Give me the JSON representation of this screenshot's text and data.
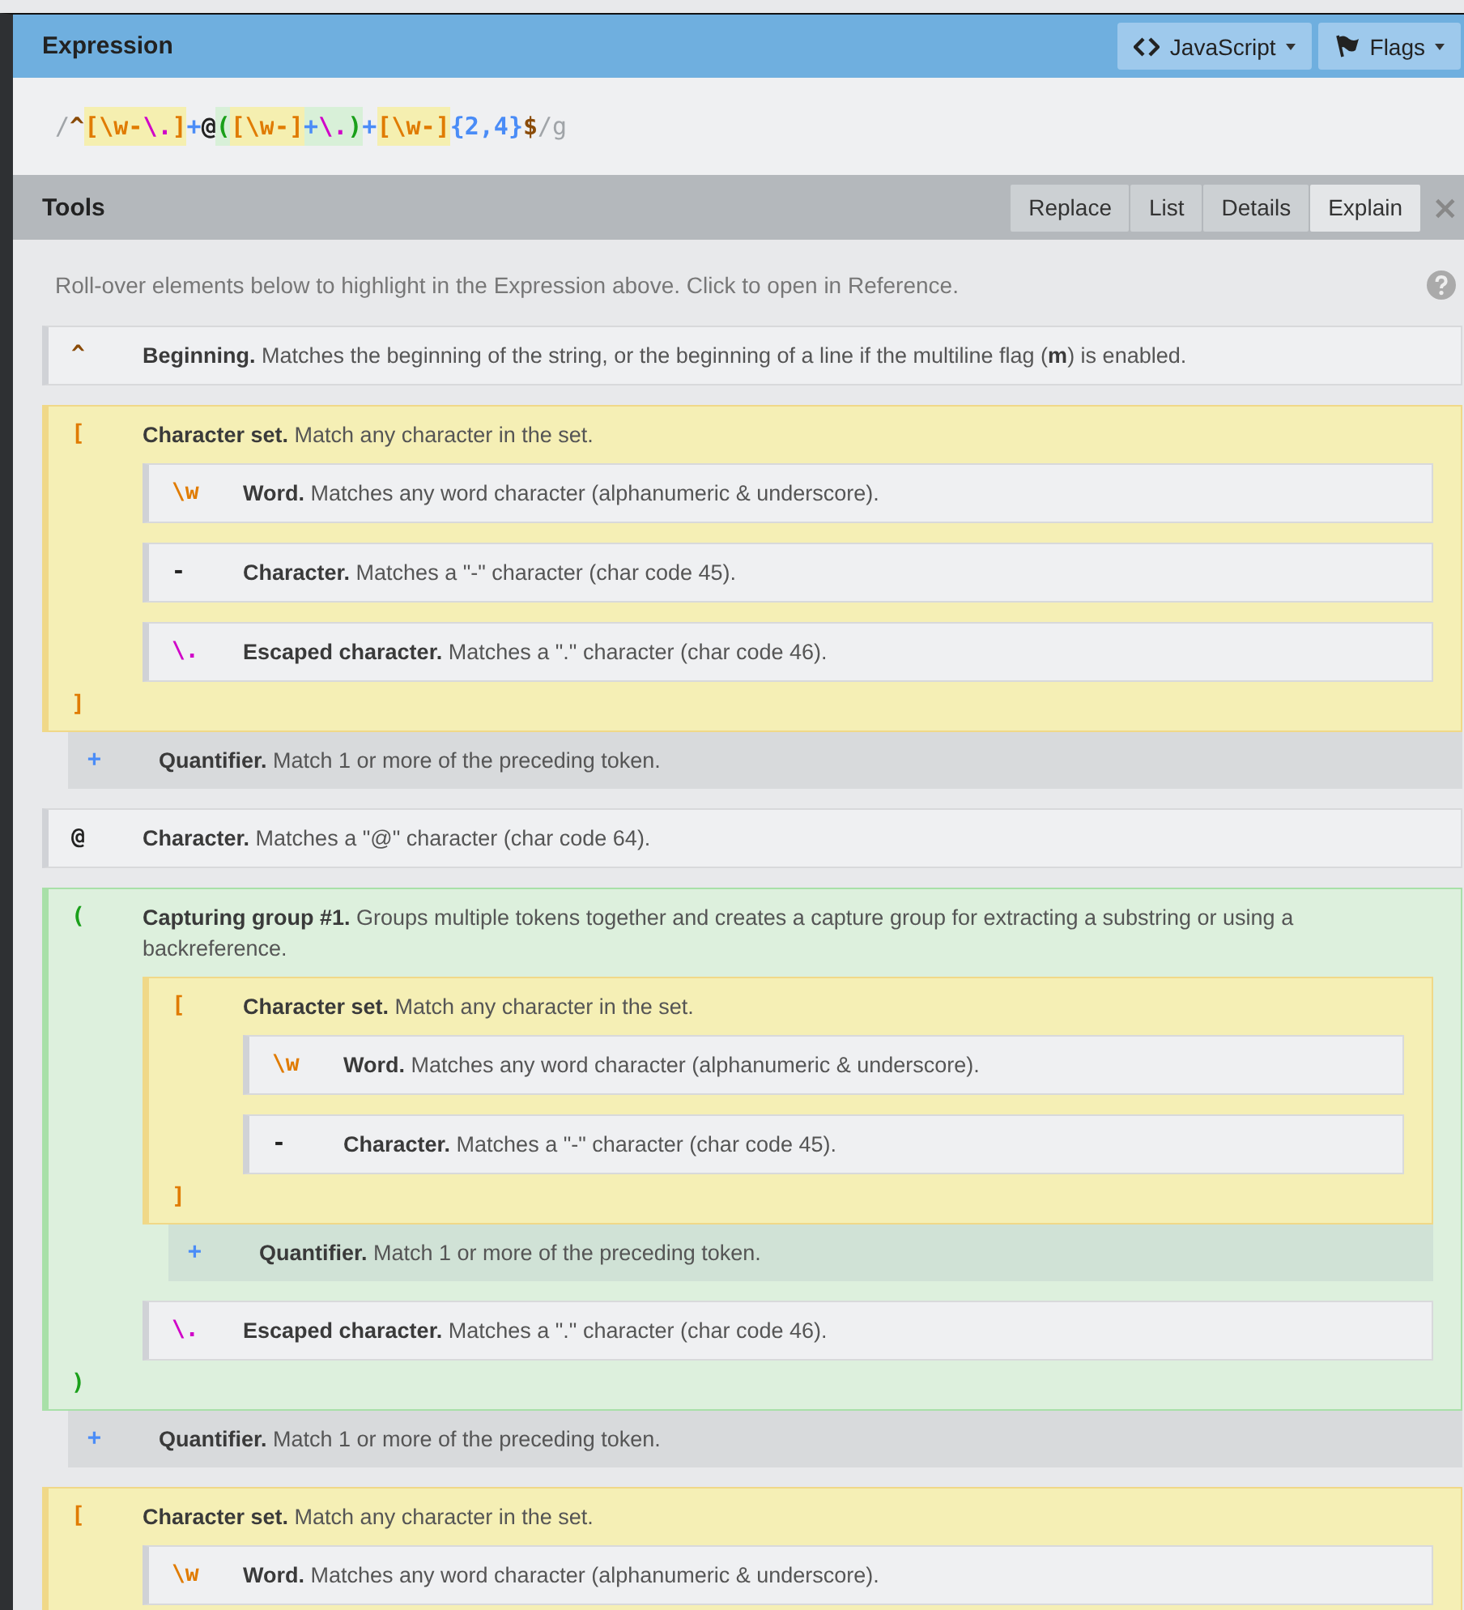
{
  "header": {
    "title": "Expression",
    "buttons": [
      {
        "kind": "code",
        "label": "JavaScript"
      },
      {
        "kind": "flag",
        "label": "Flags"
      }
    ]
  },
  "expression": [
    {
      "text": "/",
      "kind": "delim"
    },
    {
      "text": "^",
      "kind": "anchor"
    },
    {
      "text": "[",
      "kind": "set",
      "color": "#f5efb0"
    },
    {
      "text": "\\w",
      "kind": "word",
      "color": "#f5efb0"
    },
    {
      "text": "-",
      "kind": "set",
      "color": "#f5efb0"
    },
    {
      "text": "\\.",
      "kind": "escape",
      "color": "#f5efb0"
    },
    {
      "text": "]",
      "kind": "set",
      "color": "#f5efb0"
    },
    {
      "text": "+",
      "kind": "quantifier"
    },
    {
      "text": "@",
      "kind": "char"
    },
    {
      "text": "(",
      "kind": "group",
      "color": "#d8f0d8"
    },
    {
      "text": "[",
      "kind": "set",
      "color": "#f5efb0"
    },
    {
      "text": "\\w",
      "kind": "word",
      "color": "#f5efb0"
    },
    {
      "text": "-",
      "kind": "set",
      "color": "#f5efb0"
    },
    {
      "text": "]",
      "kind": "set",
      "color": "#f5efb0"
    },
    {
      "text": "+",
      "kind": "quantifier",
      "color": "#d8f0d8"
    },
    {
      "text": "\\.",
      "kind": "escape",
      "color": "#d8f0d8"
    },
    {
      "text": ")",
      "kind": "group",
      "color": "#d8f0d8"
    },
    {
      "text": "+",
      "kind": "quantifier"
    },
    {
      "text": "[",
      "kind": "set",
      "color": "#f5efb0"
    },
    {
      "text": "\\w",
      "kind": "word",
      "color": "#f5efb0"
    },
    {
      "text": "-",
      "kind": "set",
      "color": "#f5efb0"
    },
    {
      "text": "]",
      "kind": "set",
      "color": "#f5efb0"
    },
    {
      "text": "{2,4}",
      "kind": "quantifier"
    },
    {
      "text": "$",
      "kind": "anchor"
    },
    {
      "text": "/g",
      "kind": "delim"
    }
  ],
  "tools": {
    "title": "Tools",
    "close": "×",
    "tabs": [
      {
        "label": "Replace",
        "selected": false
      },
      {
        "label": "List",
        "selected": false
      },
      {
        "label": "Details",
        "selected": false
      },
      {
        "label": "Explain",
        "selected": true
      }
    ]
  },
  "explain": {
    "hint": "Roll-over elements below to highlight in the Expression above. Click to open in Reference.",
    "nodes": [
      {
        "kind": "anchor",
        "symbol": "^",
        "text": "**Beginning.** Matches the beginning of the string, or the beginning of a line if the multiline flag (**m**) is enabled."
      },
      {
        "kind": "set",
        "symbol": "[",
        "close": "]",
        "text": "**Character set.** Match any character in the set.",
        "children": [
          {
            "kind": "word",
            "symbol": "\\w",
            "text": "**Word.** Matches any word character (alphanumeric & underscore)."
          },
          {
            "kind": "char",
            "symbol": "-",
            "text": "**Character.** Matches a \"-\" character (char code 45)."
          },
          {
            "kind": "escape",
            "symbol": "\\.",
            "text": "**Escaped character.** Matches a \".\" character (char code 46)."
          }
        ]
      },
      {
        "kind": "quantifier",
        "symbol": "+",
        "text": "**Quantifier.** Match 1 or more of the preceding token."
      },
      {
        "kind": "char",
        "symbol": "@",
        "text": "**Character.** Matches a \"@\" character (char code 64)."
      },
      {
        "kind": "group",
        "symbol": "(",
        "close": ")",
        "text": "**Capturing group #1.** Groups multiple tokens together and creates a capture group for extracting a substring or using a backreference.",
        "children": [
          {
            "kind": "set",
            "symbol": "[",
            "close": "]",
            "text": "**Character set.** Match any character in the set.",
            "children": [
              {
                "kind": "word",
                "symbol": "\\w",
                "text": "**Word.** Matches any word character (alphanumeric & underscore)."
              },
              {
                "kind": "char",
                "symbol": "-",
                "text": "**Character.** Matches a \"-\" character (char code 45)."
              }
            ]
          },
          {
            "kind": "quantifier",
            "symbol": "+",
            "text": "**Quantifier.** Match 1 or more of the preceding token."
          },
          {
            "kind": "escape",
            "symbol": "\\.",
            "text": "**Escaped character.** Matches a \".\" character (char code 46)."
          }
        ]
      },
      {
        "kind": "quantifier",
        "symbol": "+",
        "text": "**Quantifier.** Match 1 or more of the preceding token."
      },
      {
        "kind": "set",
        "symbol": "[",
        "text": "**Character set.** Match any character in the set.",
        "children": [
          {
            "kind": "word",
            "symbol": "\\w",
            "text": "**Word.** Matches any word character (alphanumeric & underscore)."
          }
        ]
      }
    ]
  }
}
